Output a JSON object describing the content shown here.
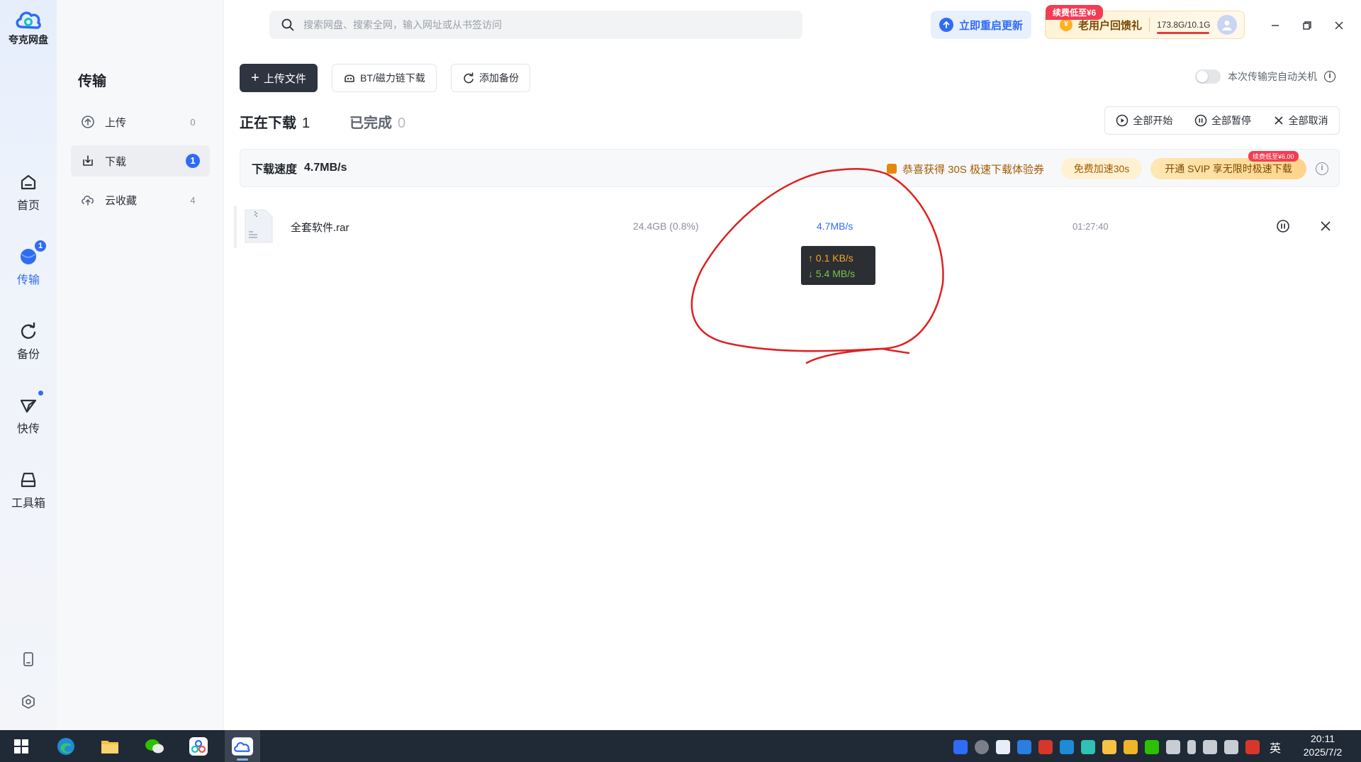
{
  "app": {
    "name": "夸克网盘"
  },
  "rail": {
    "items": [
      {
        "label": "首页",
        "icon": "home-icon"
      },
      {
        "label": "传输",
        "icon": "transfer-icon",
        "badge": "1"
      },
      {
        "label": "备份",
        "icon": "backup-icon"
      },
      {
        "label": "快传",
        "icon": "quick-send-icon"
      },
      {
        "label": "工具箱",
        "icon": "toolbox-icon"
      }
    ],
    "bottom_icons": [
      "phone-icon",
      "settings-icon"
    ]
  },
  "sidebar": {
    "title": "传输",
    "items": [
      {
        "label": "上传",
        "count": "0"
      },
      {
        "label": "下载",
        "count": "1"
      },
      {
        "label": "云收藏",
        "count": "4"
      }
    ]
  },
  "topbar": {
    "search_placeholder": "搜索网盘、搜索全网，输入网址或从书签访问",
    "update_label": "立即重启更新",
    "promo_tag": "续费低至¥6",
    "promo_label": "老用户回馈礼",
    "promo_coin": "¥",
    "storage": "173.8G/10.1G",
    "storage_fill": 1.0
  },
  "toolbar": {
    "upload_label": "上传文件",
    "bt_label": "BT/磁力链下载",
    "backup_label": "添加备份",
    "auto_shutdown_label": "本次传输完自动关机",
    "auto_shutdown_on": false
  },
  "tabs": {
    "downloading_label": "正在下载",
    "downloading_count": "1",
    "completed_label": "已完成",
    "completed_count": "0"
  },
  "controls": {
    "start_all": "全部开始",
    "pause_all": "全部暂停",
    "cancel_all": "全部取消"
  },
  "banner": {
    "speed_label": "下载速度",
    "speed_value": "4.7MB/s",
    "voucher_text": "恭喜获得 30S 极速下载体验券",
    "free_boost": "免费加速30s",
    "svip_label": "开通 SVIP 享无限时极速下载",
    "svip_tag": "续费低至¥6.00",
    "info_glyph": "i"
  },
  "downloads": [
    {
      "name": "全套软件.rar",
      "size": "24.4GB (0.8%)",
      "speed": "4.7MB/s",
      "time_left": "01:27:40"
    }
  ],
  "tooltip": {
    "up": "↑ 0.1 KB/s",
    "down": "↓ 5.4 MB/s"
  },
  "taskbar": {
    "apps": [
      "windows-start-icon",
      "edge-icon",
      "file-explorer-icon",
      "wechat-icon",
      "quark-share-icon",
      "quark-drive-icon"
    ],
    "ime": "英",
    "time": "20:11",
    "date": "2025/7/2"
  },
  "colors": {
    "accent": "#2f6cf6",
    "annotation": "#e02020",
    "taskbar": "#202a36"
  }
}
